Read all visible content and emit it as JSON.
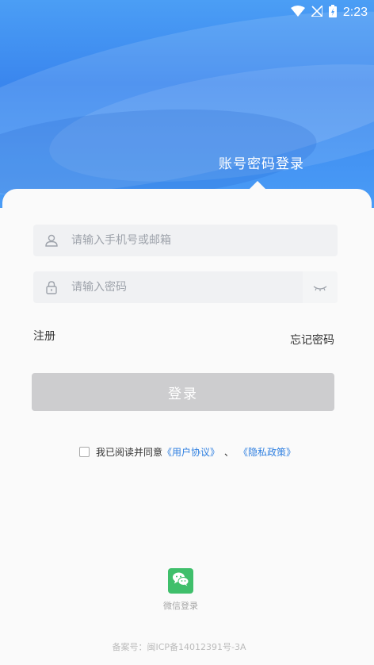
{
  "status_bar": {
    "time": "2:23",
    "icons": [
      "wifi-icon",
      "no-signal-icon",
      "battery-charging-icon"
    ]
  },
  "header": {
    "tab_label": "账号密码登录"
  },
  "form": {
    "username_placeholder": "请输入手机号或邮箱",
    "password_placeholder": "请输入密码",
    "username_icon": "user-icon",
    "password_icon": "lock-icon",
    "toggle_icon": "eye-closed-icon"
  },
  "links": {
    "register": "注册",
    "forgot_password": "忘记密码"
  },
  "login_button": "登录",
  "agreement": {
    "prefix": "我已阅读并同意",
    "user_agreement": "《用户协议》",
    "separator": "、",
    "privacy_policy": "《隐私政策》",
    "checked": false
  },
  "wechat": {
    "label": "微信登录",
    "icon": "wechat-icon"
  },
  "icp": "备案号：闽ICP备14012391号-3A",
  "colors": {
    "header_blue": "#3a86ee",
    "link_blue": "#2e7fe0",
    "login_button_disabled": "#cdcdcf",
    "wechat_green": "#3fbf6b"
  }
}
